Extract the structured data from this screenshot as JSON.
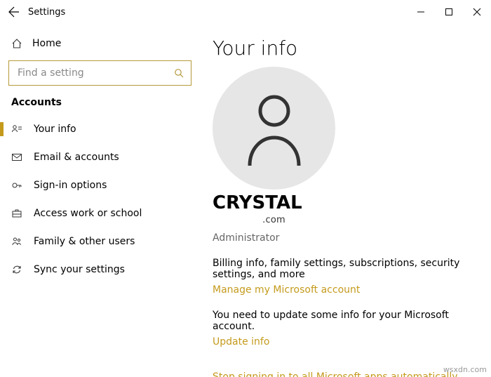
{
  "titlebar": {
    "app": "Settings"
  },
  "sidebar": {
    "home": "Home",
    "search_placeholder": "Find a setting",
    "category": "Accounts",
    "items": [
      {
        "label": "Your info"
      },
      {
        "label": "Email & accounts"
      },
      {
        "label": "Sign-in options"
      },
      {
        "label": "Access work or school"
      },
      {
        "label": "Family & other users"
      },
      {
        "label": "Sync your settings"
      }
    ]
  },
  "main": {
    "page_title": "Your info",
    "username": "CRYSTAL",
    "email": ".com",
    "role": "Administrator",
    "billing_text": "Billing info, family settings, subscriptions, security settings, and more",
    "manage_link": "Manage my Microsoft account",
    "update_text": "You need to update some info for your Microsoft account.",
    "update_link": "Update info",
    "stop_link": "Stop signing in to all Microsoft apps automatically"
  },
  "watermark": "wsxdn.com"
}
